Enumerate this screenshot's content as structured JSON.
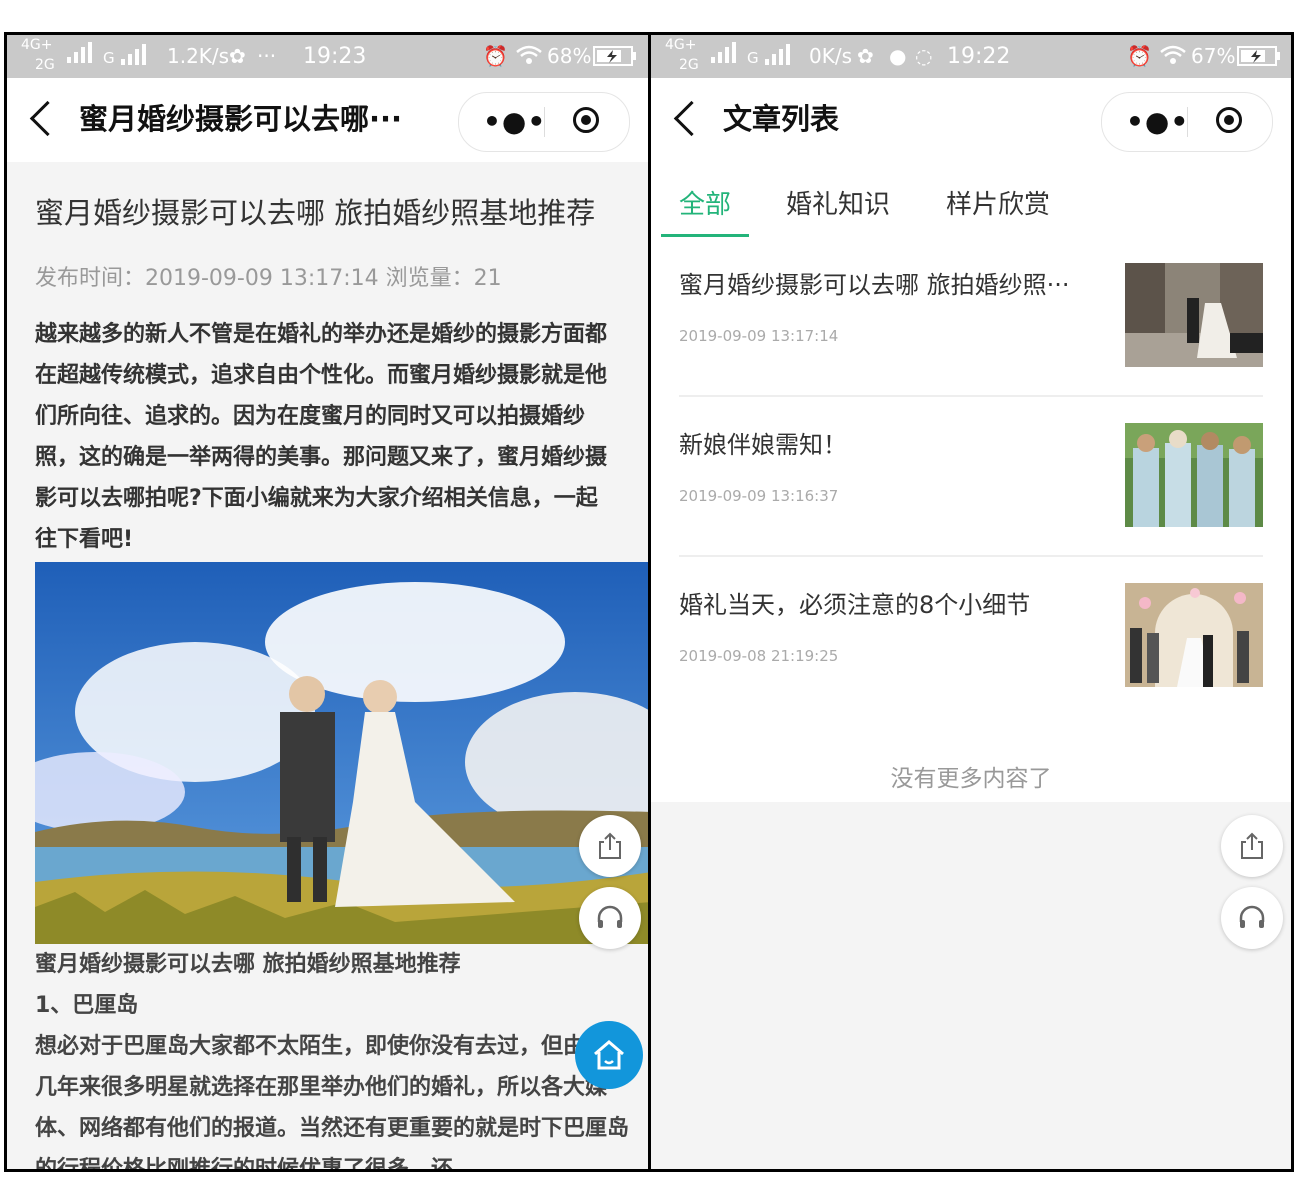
{
  "left": {
    "status": {
      "net1": "4G+",
      "net2": "2G",
      "net3": "G",
      "speed": "1.2K/s",
      "more": "···",
      "time": "19:23",
      "battery": "68%"
    },
    "nav": {
      "title": "蜜月婚纱摄影可以去哪···"
    },
    "article": {
      "title": "蜜月婚纱摄影可以去哪 旅拍婚纱照基地推荐",
      "meta": "发布时间：2019-09-09 13:17:14 浏览量：21",
      "intro": "越来越多的新人不管是在婚礼的举办还是婚纱的摄影方面都在超越传统模式，追求自由个性化。而蜜月婚纱摄影就是他们所向往、追求的。因为在度蜜月的同时又可以拍摄婚纱照，这的确是一举两得的美事。那问题又来了，蜜月婚纱摄影可以去哪拍呢?下面小编就来为大家介绍相关信息，一起往下看吧!",
      "caption_title": "蜜月婚纱摄影可以去哪 旅拍婚纱照基地推荐",
      "section": "1、巴厘岛",
      "para": "想必对于巴厘岛大家都不太陌生，即使你没有去过，但由于近几年来很多明星就选择在那里举办他们的婚礼，所以各大媒体、网络都有他们的报道。当然还有更重要的就是时下巴厘岛的行程价格比刚推行的时候优惠了很多，还"
    }
  },
  "right": {
    "status": {
      "net1": "4G+",
      "net2": "2G",
      "net3": "G",
      "speed": "0K/s",
      "time": "19:22",
      "battery": "67%"
    },
    "nav": {
      "title": "文章列表"
    },
    "tabs": [
      "全部",
      "婚礼知识",
      "样片欣赏"
    ],
    "articles": [
      {
        "title": "蜜月婚纱摄影可以去哪 旅拍婚纱照···",
        "date": "2019-09-09 13:17:14"
      },
      {
        "title": "新娘伴娘需知！",
        "date": "2019-09-09 13:16:37"
      },
      {
        "title": "婚礼当天，必须注意的8个小细节",
        "date": "2019-09-08 21:19:25"
      }
    ],
    "no_more": "没有更多内容了"
  }
}
